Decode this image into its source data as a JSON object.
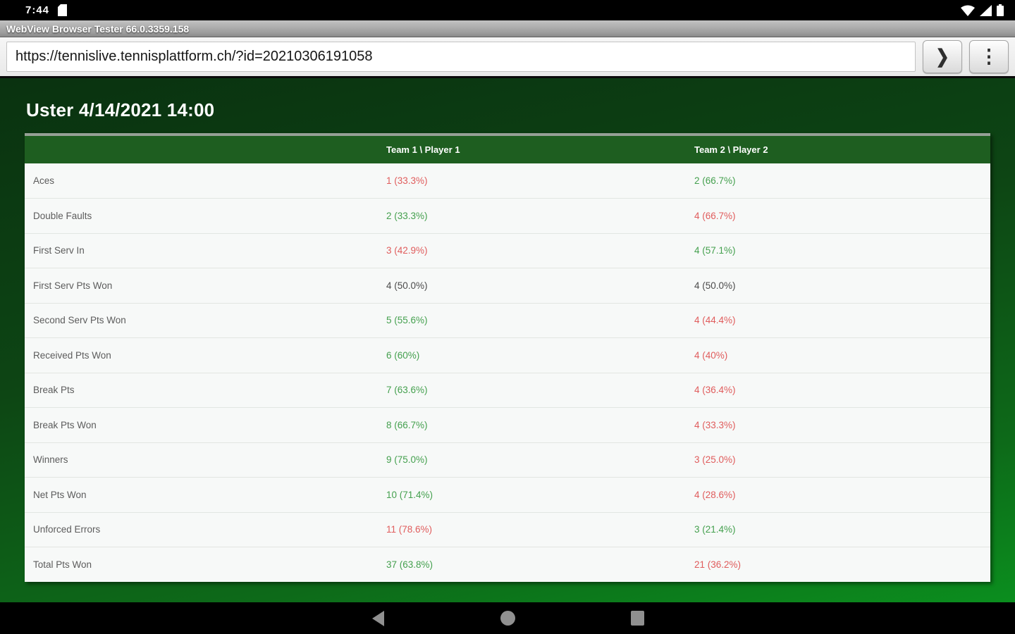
{
  "status_bar": {
    "time": "7:44",
    "left_icons": [
      "sd-card-icon"
    ],
    "right_icons": [
      "wifi-icon",
      "signal-icon",
      "battery-icon"
    ]
  },
  "app_bar": {
    "title": "WebView Browser Tester 66.0.3359.158"
  },
  "toolbar": {
    "url": "https://tennislive.tennisplattform.ch/?id=20210306191058",
    "go_label": "❯",
    "menu_label": "⋮"
  },
  "page": {
    "title": "Uster 4/14/2021 14:00",
    "table": {
      "team1_header": "Team 1 \\ Player 1",
      "team2_header": "Team 2 \\ Player 2",
      "rows": [
        {
          "label": "Aces",
          "team1": {
            "text": "1 (33.3%)",
            "color": "red"
          },
          "team2": {
            "text": "2 (66.7%)",
            "color": "green"
          }
        },
        {
          "label": "Double Faults",
          "team1": {
            "text": "2 (33.3%)",
            "color": "green"
          },
          "team2": {
            "text": "4 (66.7%)",
            "color": "red"
          }
        },
        {
          "label": "First Serv In",
          "team1": {
            "text": "3 (42.9%)",
            "color": "red"
          },
          "team2": {
            "text": "4 (57.1%)",
            "color": "green"
          }
        },
        {
          "label": "First Serv Pts Won",
          "team1": {
            "text": "4 (50.0%)",
            "color": "neutral"
          },
          "team2": {
            "text": "4 (50.0%)",
            "color": "neutral"
          }
        },
        {
          "label": "Second Serv Pts Won",
          "team1": {
            "text": "5 (55.6%)",
            "color": "green"
          },
          "team2": {
            "text": "4 (44.4%)",
            "color": "red"
          }
        },
        {
          "label": "Received Pts Won",
          "team1": {
            "text": "6 (60%)",
            "color": "green"
          },
          "team2": {
            "text": "4 (40%)",
            "color": "red"
          }
        },
        {
          "label": "Break Pts",
          "team1": {
            "text": "7 (63.6%)",
            "color": "green"
          },
          "team2": {
            "text": "4 (36.4%)",
            "color": "red"
          }
        },
        {
          "label": "Break Pts Won",
          "team1": {
            "text": "8 (66.7%)",
            "color": "green"
          },
          "team2": {
            "text": "4 (33.3%)",
            "color": "red"
          }
        },
        {
          "label": "Winners",
          "team1": {
            "text": "9 (75.0%)",
            "color": "green"
          },
          "team2": {
            "text": "3 (25.0%)",
            "color": "red"
          }
        },
        {
          "label": "Net Pts Won",
          "team1": {
            "text": "10 (71.4%)",
            "color": "green"
          },
          "team2": {
            "text": "4 (28.6%)",
            "color": "red"
          }
        },
        {
          "label": "Unforced Errors",
          "team1": {
            "text": "11 (78.6%)",
            "color": "red"
          },
          "team2": {
            "text": "3 (21.4%)",
            "color": "green"
          }
        },
        {
          "label": "Total Pts Won",
          "team1": {
            "text": "37 (63.8%)",
            "color": "green"
          },
          "team2": {
            "text": "21 (36.2%)",
            "color": "red"
          }
        }
      ]
    }
  },
  "nav_bar": {
    "icons": [
      "back-icon",
      "home-icon",
      "recents-icon"
    ]
  },
  "colors": {
    "positive_value": "#44a04e",
    "negative_value": "#e05c5c",
    "neutral_value": "#4b4b4b",
    "table_header_green": "#1e5e20",
    "page_gradient_top": "#0a3210",
    "page_gradient_bottom": "#0b8e1e"
  }
}
